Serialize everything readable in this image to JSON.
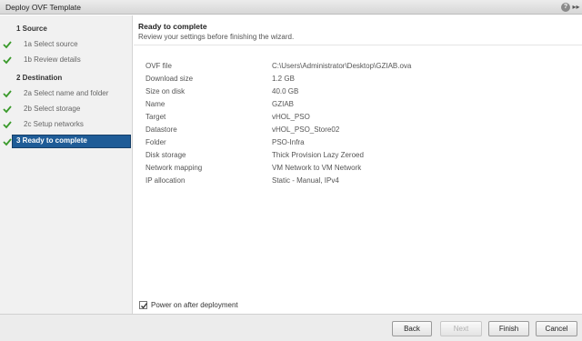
{
  "window": {
    "title": "Deploy OVF Template",
    "help_label": "?",
    "expand_label": "▸▸"
  },
  "sidebar": {
    "steps": [
      {
        "label": "1  Source",
        "completed": false,
        "main": true
      },
      {
        "label": "1a  Select source",
        "completed": true
      },
      {
        "label": "1b  Review details",
        "completed": true
      },
      {
        "label": "2  Destination",
        "completed": false,
        "main": true
      },
      {
        "label": "2a  Select name and folder",
        "completed": true
      },
      {
        "label": "2b  Select storage",
        "completed": true
      },
      {
        "label": "2c  Setup networks",
        "completed": true
      },
      {
        "label": "3  Ready to complete",
        "completed": true,
        "active": true
      }
    ]
  },
  "main": {
    "title": "Ready to complete",
    "subtitle": "Review your settings before finishing the wizard.",
    "settings": [
      {
        "label": "OVF file",
        "value": "C:\\Users\\Administrator\\Desktop\\GZIAB.ova"
      },
      {
        "label": "Download size",
        "value": "1.2 GB"
      },
      {
        "label": "Size on disk",
        "value": "40.0 GB"
      },
      {
        "label": "Name",
        "value": "GZIAB"
      },
      {
        "label": "Target",
        "value": "vHOL_PSO"
      },
      {
        "label": "Datastore",
        "value": "vHOL_PSO_Store02"
      },
      {
        "label": "Folder",
        "value": "PSO-Infra"
      },
      {
        "label": "Disk storage",
        "value": "Thick Provision Lazy Zeroed"
      },
      {
        "label": "Network mapping",
        "value": "VM Network to VM Network"
      },
      {
        "label": "IP allocation",
        "value": "Static - Manual, IPv4"
      }
    ],
    "power_on": {
      "label": "Power on after deployment",
      "checked": true
    }
  },
  "footer": {
    "back_label": "Back",
    "next_label": "Next",
    "finish_label": "Finish",
    "cancel_label": "Cancel"
  },
  "colors": {
    "active_step": "#1f5c97",
    "check": "#3a9a2b"
  }
}
